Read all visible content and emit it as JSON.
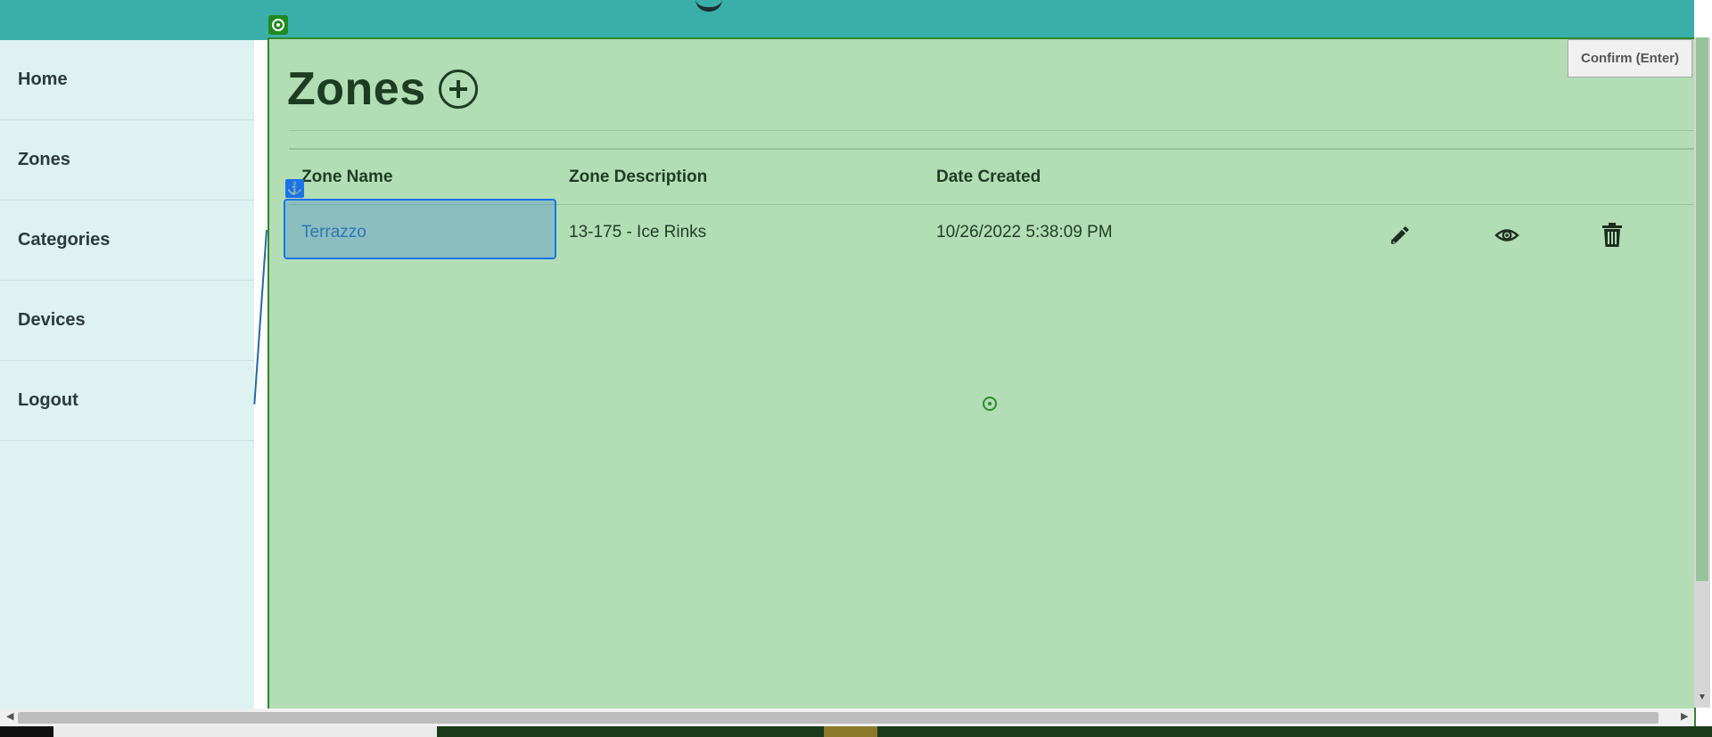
{
  "sidebar": {
    "items": [
      {
        "label": "Home"
      },
      {
        "label": "Zones"
      },
      {
        "label": "Categories"
      },
      {
        "label": "Devices"
      },
      {
        "label": "Logout"
      }
    ]
  },
  "main": {
    "title": "Zones",
    "table": {
      "headers": [
        "Zone Name",
        "Zone Description",
        "Date Created"
      ],
      "rows": [
        {
          "name": "Terrazzo",
          "description": "13-175 - Ice Rinks",
          "date": "10/26/2022 5:38:09 PM"
        }
      ]
    }
  },
  "overlay": {
    "confirm_label": "Confirm (Enter)",
    "anchor_glyph": "⚓"
  },
  "icons": {
    "add": "plus-circle-icon",
    "edit": "pencil-icon",
    "view": "eye-icon",
    "delete": "trash-icon"
  },
  "colors": {
    "topbar": "#3aafa9",
    "sidebar": "#def2f1",
    "main_overlay": "#b3ddb4",
    "link": "#2568a8",
    "selection": "#1a73e8"
  }
}
